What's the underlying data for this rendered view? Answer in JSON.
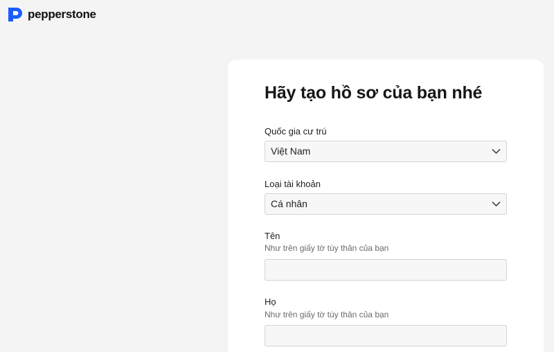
{
  "brand": {
    "name": "pepperstone",
    "logo_color": "#1a5cff"
  },
  "form": {
    "title": "Hãy tạo hồ sơ của bạn nhé",
    "country": {
      "label": "Quốc gia cư trú",
      "value": "Việt Nam"
    },
    "account_type": {
      "label": "Loại tài khoản",
      "value": "Cá nhân"
    },
    "first_name": {
      "label": "Tên",
      "hint": "Như trên giấy tờ tùy thân của bạn",
      "value": ""
    },
    "last_name": {
      "label": "Họ",
      "hint": "Như trên giấy tờ tùy thân của bạn",
      "value": ""
    }
  },
  "icons": {
    "select_chevron": "chevron-down-icon",
    "logo": "pepperstone-logo-icon"
  }
}
